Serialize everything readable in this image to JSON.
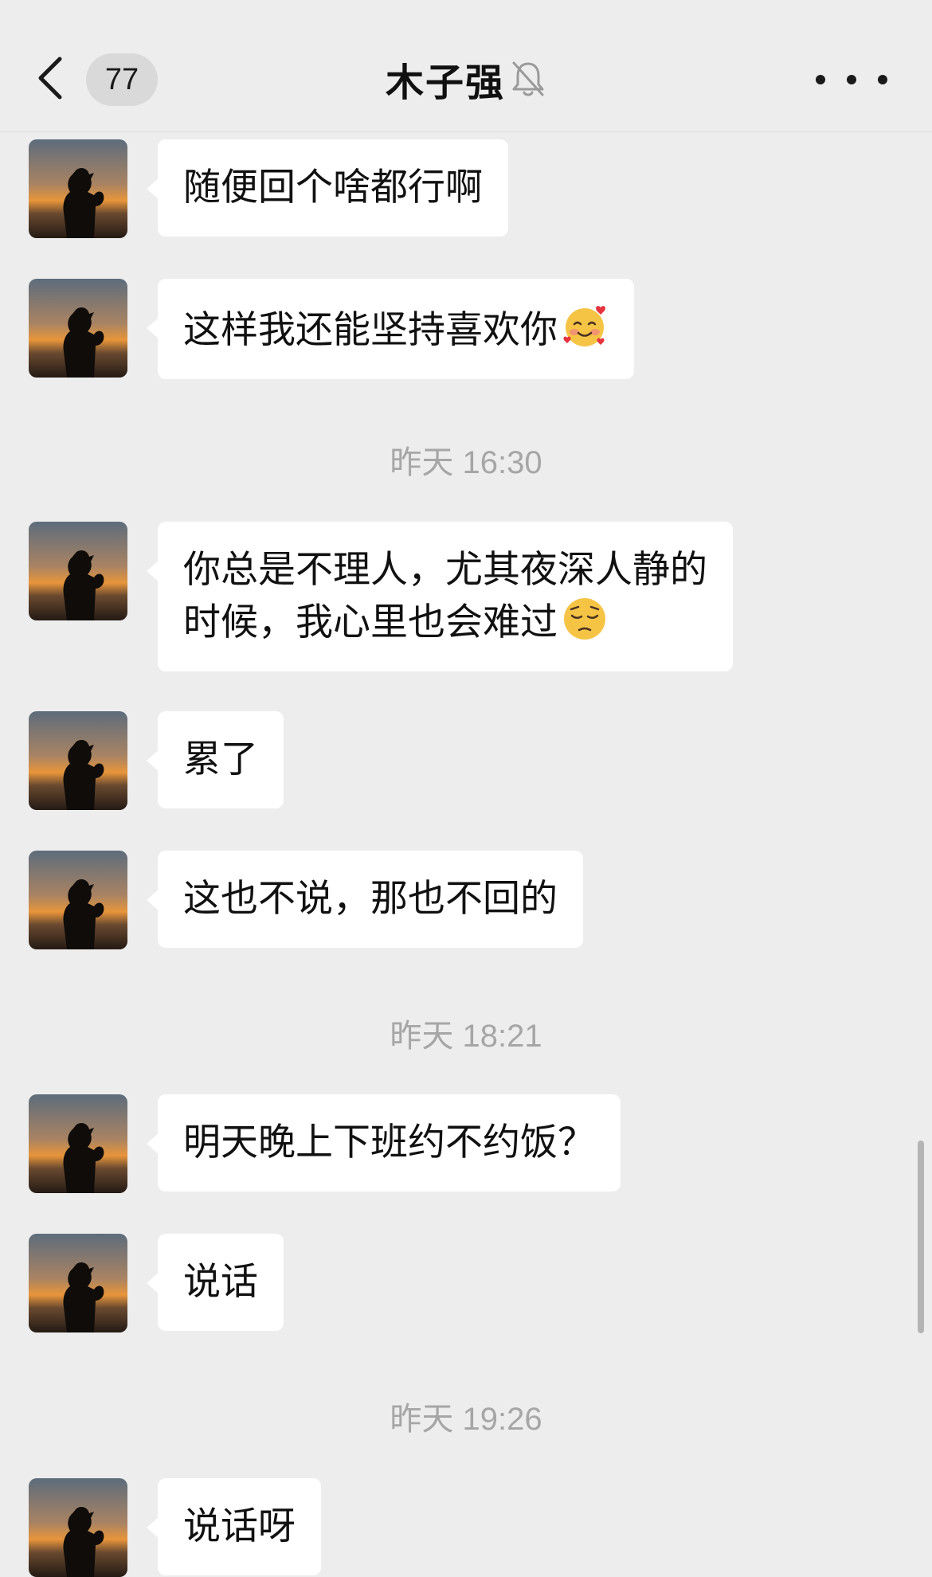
{
  "header": {
    "back_icon": "chevron-left-icon",
    "unread_count": "77",
    "title": "木子强",
    "mute_icon": "bell-slash-icon",
    "more_icon": "ellipsis-icon"
  },
  "avatar_icon": "sunset-silhouette-avatar",
  "messages": [
    {
      "type": "text",
      "text": "随便回个啥都行啊"
    },
    {
      "type": "text",
      "text": "这样我还能坚持喜欢你",
      "emoji": "smiling-face-with-hearts"
    },
    {
      "type": "time",
      "text": "昨天 16:30"
    },
    {
      "type": "text",
      "lines": [
        "你总是不理人，尤其夜深人静的",
        "时候，我心里也会难过"
      ],
      "emoji": "pensive-face"
    },
    {
      "type": "text",
      "text": "累了"
    },
    {
      "type": "text",
      "text": "这也不说，那也不回的"
    },
    {
      "type": "time",
      "text": "昨天 18:21"
    },
    {
      "type": "text",
      "text": "明天晚上下班约不约饭？"
    },
    {
      "type": "text",
      "text": "说话"
    },
    {
      "type": "time",
      "text": "昨天 19:26"
    },
    {
      "type": "text",
      "text": "说话呀"
    }
  ],
  "colors": {
    "background": "#ededed",
    "bubble": "#ffffff",
    "timestamp": "#a6a6a6",
    "badge": "#d9d9d9"
  }
}
